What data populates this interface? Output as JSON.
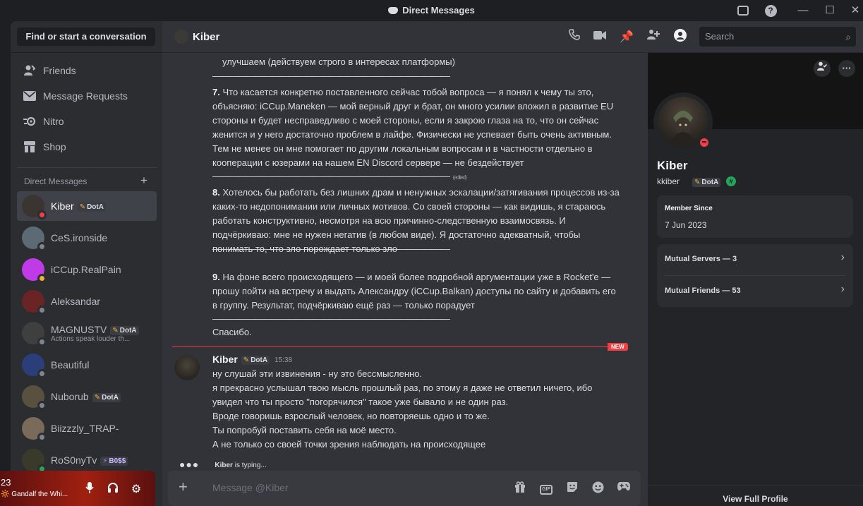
{
  "window": {
    "title": "Direct Messages",
    "min_glyph": "—",
    "max_glyph": "☐",
    "close_glyph": "✕"
  },
  "sidebar": {
    "search_placeholder": "Find or start a conversation",
    "nav": [
      {
        "label": "Friends",
        "icon": "friends-icon"
      },
      {
        "label": "Message Requests",
        "icon": "envelope-icon"
      },
      {
        "label": "Nitro",
        "icon": "nitro-icon"
      },
      {
        "label": "Shop",
        "icon": "shop-icon"
      }
    ],
    "dm_header": "Direct Messages",
    "dms": [
      {
        "name": "Kiber",
        "tag": "DotA",
        "status": "dnd",
        "active": true,
        "avatar_color": "#3a3530"
      },
      {
        "name": "CeS.ironside",
        "tag": "",
        "status": "offline",
        "avatar_color": "#5b6a75"
      },
      {
        "name": "iCCup.RealPain",
        "tag": "",
        "status": "idle",
        "avatar_color": "#c03ae8"
      },
      {
        "name": "Aleksandar",
        "tag": "",
        "status": "offline",
        "avatar_color": "#6b2424"
      },
      {
        "name": "MAGNUSTV",
        "tag": "DotA",
        "status": "offline",
        "sub": "Actions speak louder th...",
        "avatar_color": "#3f3f3f"
      },
      {
        "name": "Beautiful",
        "tag": "",
        "status": "offline",
        "avatar_color": "#2a3f7a"
      },
      {
        "name": "Nuborub",
        "tag": "DotA",
        "status": "offline",
        "avatar_color": "#5a5040"
      },
      {
        "name": "Biizzzly_TRAP-",
        "tag": "",
        "status": "offline",
        "avatar_color": "#7a6a5a"
      },
      {
        "name": "RoS0nyTv",
        "tag": "B0$$",
        "status": "online",
        "avatar_color": "#3a3a2a"
      }
    ]
  },
  "user_panel": {
    "count": "23",
    "status": "🔆 Gandalf the Whi..."
  },
  "chat_header": {
    "name": "Kiber",
    "search_placeholder": "Search"
  },
  "messages": {
    "block1_line": "улучшаем (действуем строго в интересах платформы)",
    "separator": "————————————————————————————",
    "p7_num": "7.",
    "p7": "Что касается конкретно поставленного сейчас тобой вопроса — я понял к чему ты это, объясняю: iCCup.Maneken — мой верный друг и брат, он много усилии вложил в развитие EU стороны и будет несправедливо с моей стороны, если я закрою глаза на то, что он сейчас женится и у него достаточно проблем в лайфе. Физически не успевает быть очень активным. Тем не менее он мне помогает по другим локальным вопросам и в частности отдельно в кооперации с юзерами на нашем EN Discord сервере — не бездействует",
    "edited": "(edited)",
    "p8_num": "8.",
    "p8": "Хотелось бы работать без лишних драм и ненужных эскалации/затягивания процессов из-за каких-то недопонимании или личных мотивов. Со своей стороны — как видишь, я стараюсь работать конструктивно, несмотря на всю причинно-следственную взаимосвязь. И подчёркиваю: мне не нужен негатив (в любом виде). Я достаточно адекватный, чтобы понимать то, что зло порождает только зло",
    "p9_num": "9.",
    "p9": "На фоне всего происходящего — и моей более подробной аргументации уже в Rocket'e — прошу пойти на встречу и выдать Александру (iCCup.Balkan) доступы по сайту и добавить его в группу. Результат, подчёркиваю ещё раз — только порадует",
    "thanks": "Спасибо.",
    "new_label": "NEW",
    "author": "Kiber",
    "author_tag": "DotA",
    "time": "15:38",
    "lines": [
      "ну слушай эти извинения - ну это бессмысленно.",
      "я прекрасно услышал твою мысль прошлый раз, по этому я даже не ответил ничего, ибо увидел что ты просто \"погорячился\" такое уже бывало и не один раз.",
      "Вроде говоришь взрослый человек, но повторяешь одно и то же.",
      "Ты попробуй поставить себя на моё место.",
      "А не только со своей точки зрения наблюдать на происходящее"
    ],
    "typing_user": "Kiber",
    "typing_text": " is typing..."
  },
  "composer": {
    "placeholder": "Message @Kiber",
    "gif_label": "GIF"
  },
  "profile": {
    "display_name": "Kiber",
    "username": "kkiber",
    "tag": "DotA",
    "member_since_label": "Member Since",
    "member_since": "7 Jun 2023",
    "mutual_servers": "Mutual Servers — 3",
    "mutual_friends": "Mutual Friends — 53",
    "footer": "View Full Profile"
  },
  "colors": {
    "accent_red": "#f23f43",
    "online": "#23a55a",
    "idle": "#f0b232"
  }
}
